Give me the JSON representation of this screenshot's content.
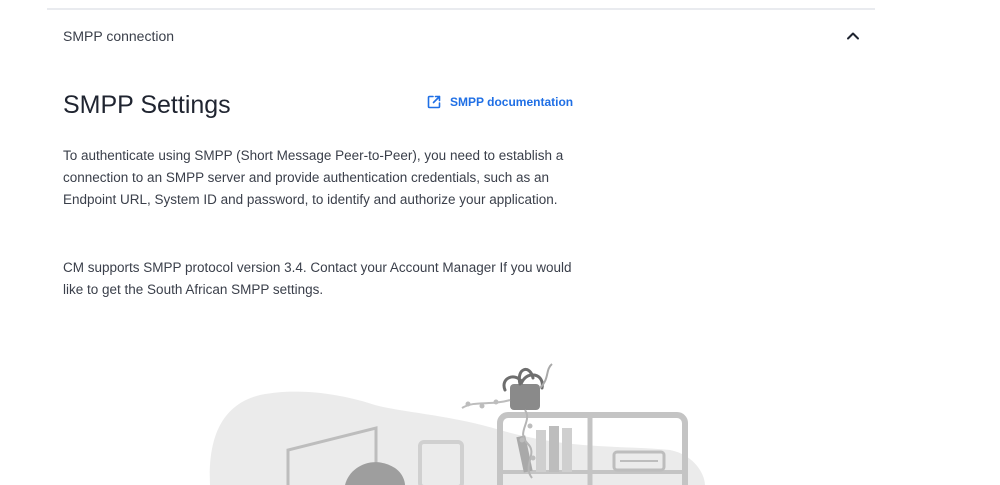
{
  "accordion": {
    "title": "SMPP connection",
    "toggle_icon": "chevron-up-icon",
    "expanded": true
  },
  "settings": {
    "heading": "SMPP Settings",
    "doc_link_label": "SMPP documentation",
    "doc_link_icon": "external-link-icon",
    "paragraph1": "To authenticate using SMPP (Short Message Peer-to-Peer), you need to establish a connection to an SMPP server and provide authentication credentials, such as an Endpoint URL, System ID and password, to identify and authorize your application.",
    "paragraph2": "CM supports SMPP protocol version 3.4. Contact your Account Manager If you would like to get the South African SMPP settings."
  },
  "colors": {
    "link": "#1f6fe5",
    "text": "#3a3f4a",
    "illustration_gray": "#e6e6e6"
  }
}
